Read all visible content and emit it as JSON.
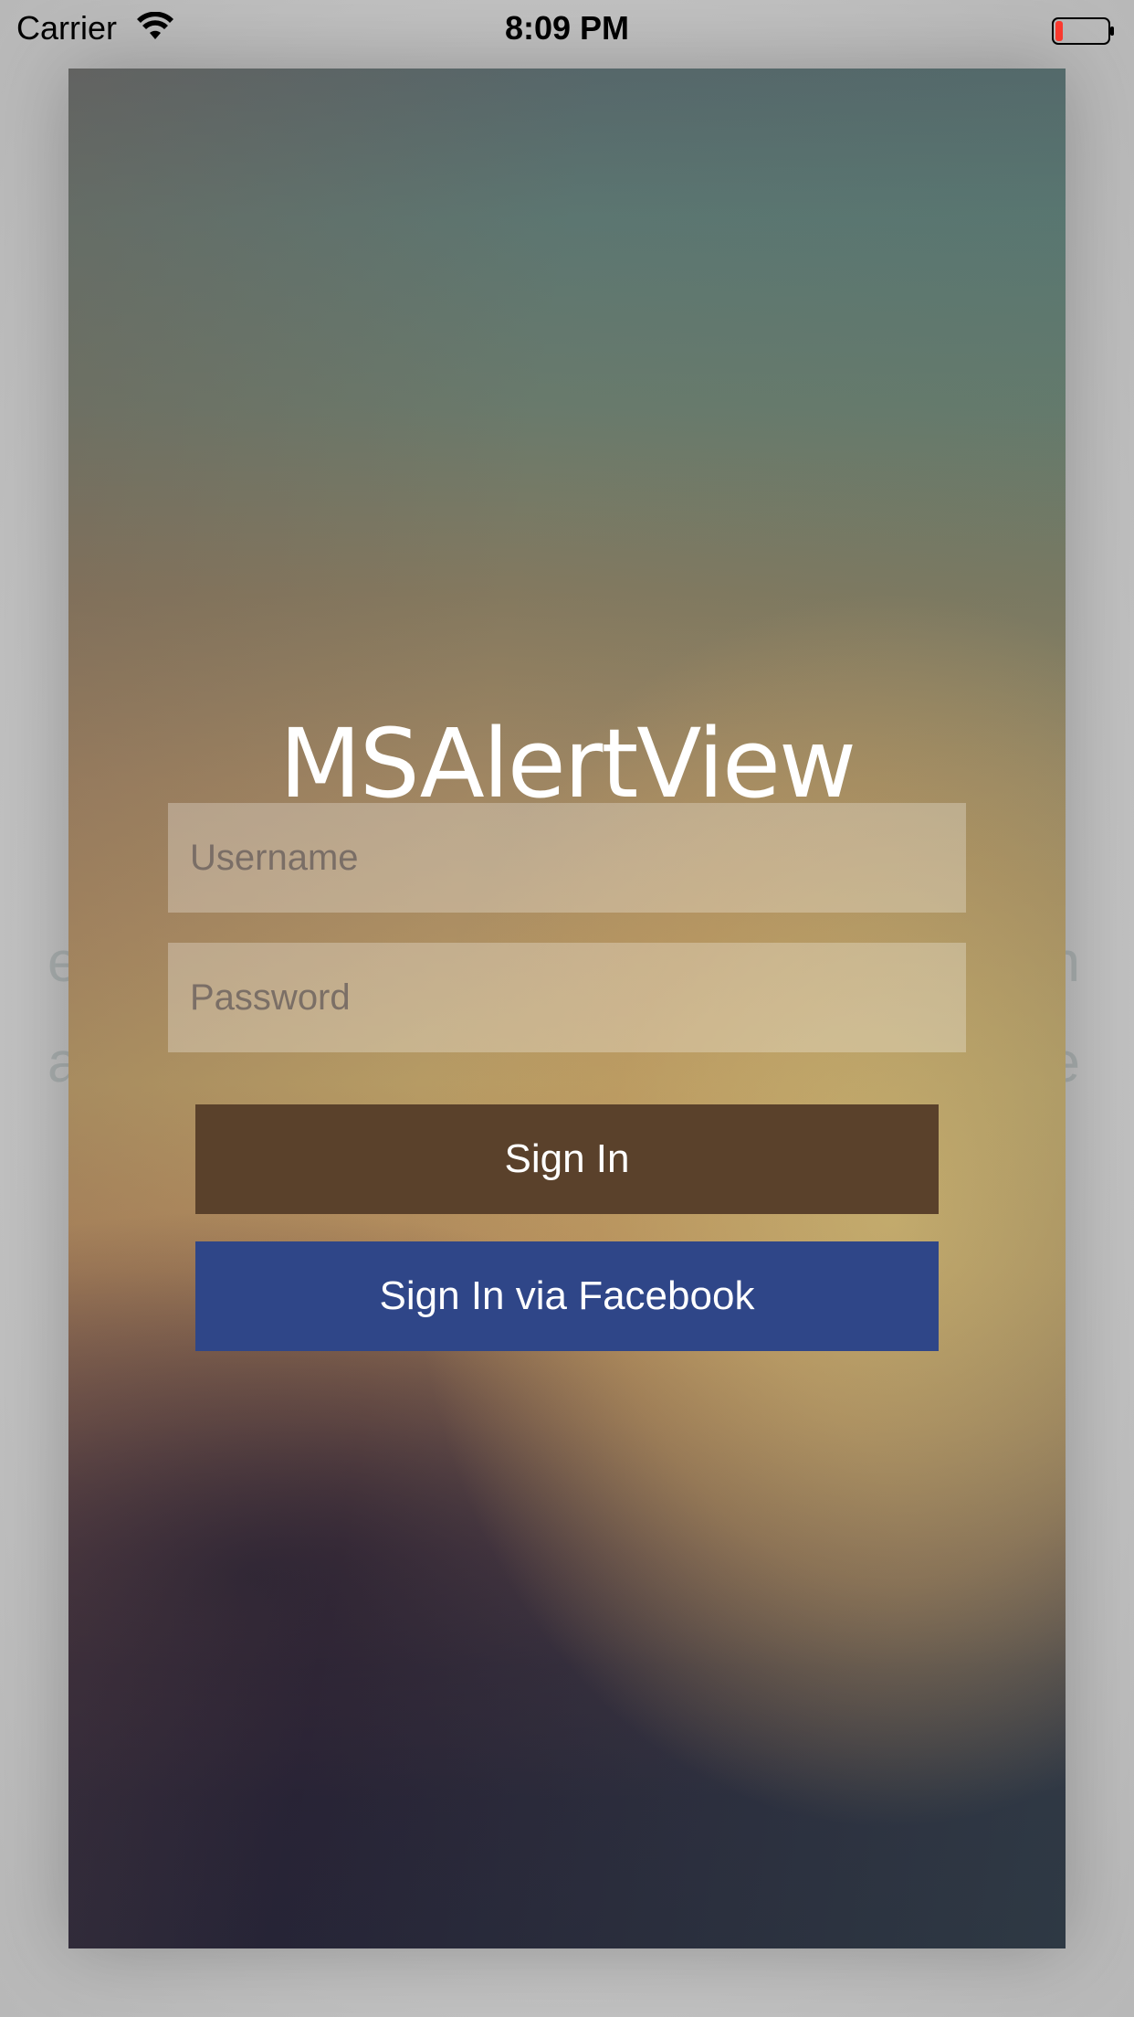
{
  "status_bar": {
    "carrier": "Carrier",
    "time": "8:09 PM",
    "battery_level": 0.15,
    "battery_color": "#ff3b30"
  },
  "background": {
    "line1_left": "e",
    "line1_right": "n",
    "line2_left": "a",
    "line2_right": "e"
  },
  "alert": {
    "title": "MSAlertView",
    "username_placeholder": "Username",
    "password_placeholder": "Password",
    "sign_in_label": "Sign In",
    "facebook_label": "Sign In via Facebook",
    "colors": {
      "sign_in": "#5a412b",
      "facebook": "#2f4688"
    }
  }
}
